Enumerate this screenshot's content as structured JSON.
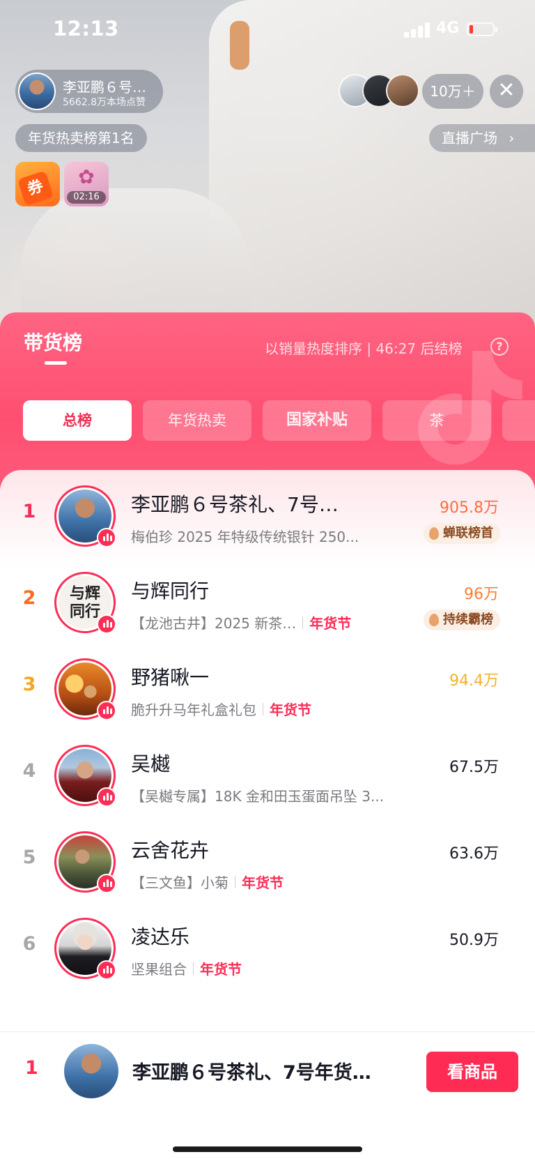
{
  "status_bar": {
    "time": "12:13",
    "network": "4G",
    "battery_level": 0.1
  },
  "live": {
    "host_name": "李亚鹏６号…",
    "host_likes": "5662.8万本场点赞",
    "viewer_count": "10万＋",
    "rank_badge": "年货热卖榜第1名",
    "plaza_link": "直播广场",
    "coupon_label": "券",
    "gift_timer": "02:16"
  },
  "ranking": {
    "title": "带货榜",
    "sort_note": "以销量热度排序 | 46:27 后结榜",
    "help_icon": "?",
    "tabs": [
      {
        "label": "总榜",
        "active": true
      },
      {
        "label": "年货热卖",
        "active": false
      },
      {
        "label": "国家补贴",
        "active": false
      },
      {
        "label": "茶",
        "active": false
      }
    ],
    "rows": [
      {
        "rank": "1",
        "name": "李亚鹏６号茶礼、7号…",
        "subtitle": "梅伯珍 2025 年特级传统银针 250...",
        "tag": "",
        "value": "905.8万",
        "honor": "蝉联榜首"
      },
      {
        "rank": "2",
        "name": "与辉同行",
        "subtitle": "【龙池古井】2025 新茶…",
        "tag": "年货节",
        "value": "96万",
        "honor": "持续霸榜"
      },
      {
        "rank": "3",
        "name": "野猪啾一",
        "subtitle": "脆升升马年礼盒礼包",
        "tag": "年货节",
        "value": "94.4万",
        "honor": ""
      },
      {
        "rank": "4",
        "name": "吴樾",
        "subtitle": "【吴樾专属】18K 金和田玉蛋面吊坠 3...",
        "tag": "",
        "value": "67.5万",
        "honor": ""
      },
      {
        "rank": "5",
        "name": "云舍花卉",
        "subtitle": "【三文鱼】小菊",
        "tag": "年货节",
        "value": "63.6万",
        "honor": ""
      },
      {
        "rank": "6",
        "name": "凌达乐",
        "subtitle": "坚果组合",
        "tag": "年货节",
        "value": "50.9万",
        "honor": ""
      }
    ]
  },
  "bottom_bar": {
    "rank": "1",
    "name": "李亚鹏６号茶礼、7号年货…",
    "button_label": "看商品"
  },
  "colors": {
    "accent": "#fe2c55",
    "rank1": "#f12e53",
    "rank2": "#ff6a1e",
    "rank3": "#f5a623",
    "rank_other": "#a6a7ab",
    "value_top1": "#ff6b3d",
    "value_top2": "#ff7d2e",
    "value_top3": "#f5b02a"
  }
}
